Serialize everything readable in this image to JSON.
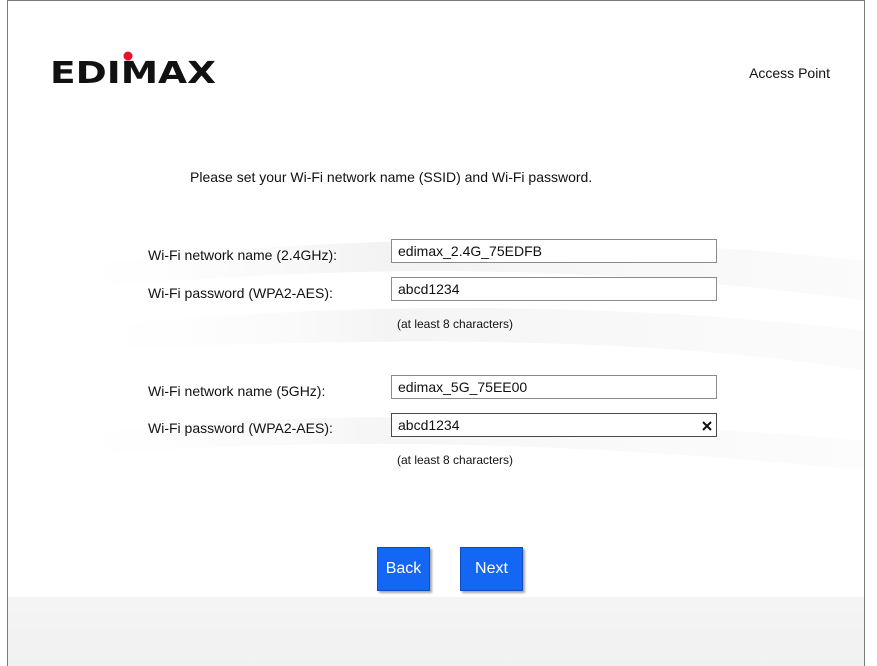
{
  "header": {
    "brand": "EDIMAX",
    "mode": "Access Point"
  },
  "instruction": "Please set your Wi-Fi network name (SSID) and Wi-Fi password.",
  "band_24": {
    "ssid_label": "Wi-Fi network name (2.4GHz):",
    "ssid_value": "edimax_2.4G_75EDFB",
    "password_label": "Wi-Fi password (WPA2-AES):",
    "password_value": "abcd1234",
    "hint": "(at least 8 characters)"
  },
  "band_5": {
    "ssid_label": "Wi-Fi network name (5GHz):",
    "ssid_value": "edimax_5G_75EE00",
    "password_label": "Wi-Fi password (WPA2-AES):",
    "password_value": "abcd1234",
    "hint": "(at least 8 characters)",
    "clear_icon": "close-icon"
  },
  "buttons": {
    "back": "Back",
    "next": "Next"
  },
  "colors": {
    "button_bg": "#1466f4",
    "logo_dot": "#e8112d",
    "logo_text": "#111111"
  }
}
